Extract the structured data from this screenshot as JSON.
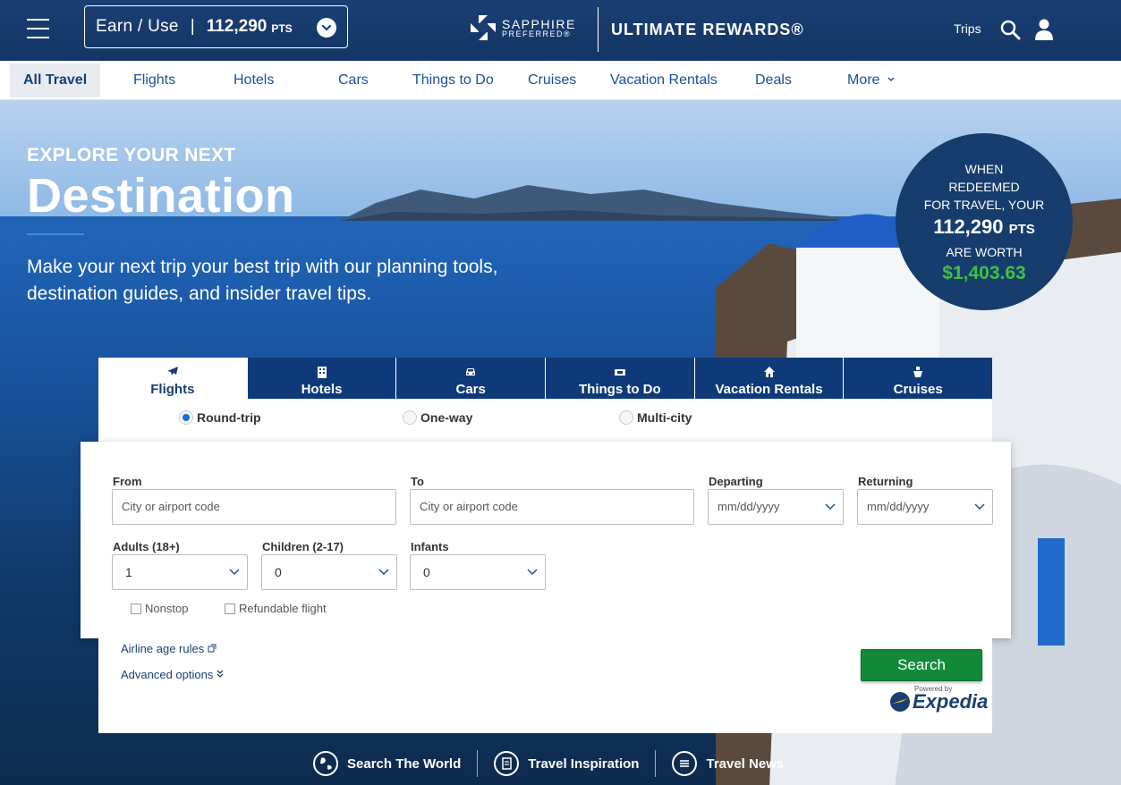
{
  "header": {
    "earn_label": "Earn / Use",
    "separator": "|",
    "points": "112,290",
    "points_unit": "PTS",
    "brand_line1": "SAPPHIRE",
    "brand_line2": "PREFERRED®",
    "program": "ULTIMATE REWARDS®",
    "trips": "Trips"
  },
  "nav": {
    "items": [
      {
        "label": "All Travel"
      },
      {
        "label": "Flights"
      },
      {
        "label": "Hotels"
      },
      {
        "label": "Cars"
      },
      {
        "label": "Things to Do"
      },
      {
        "label": "Cruises"
      },
      {
        "label": "Vacation Rentals"
      },
      {
        "label": "Deals"
      },
      {
        "label": "More ⌵"
      }
    ],
    "more_label": "More"
  },
  "hero": {
    "kicker": "EXPLORE YOUR NEXT",
    "title": "Destination",
    "subtitle": "Make your next trip your best trip with our planning tools, destination guides, and insider travel tips."
  },
  "redeem": {
    "line1": "WHEN",
    "line2": "REDEEMED",
    "line3": "FOR TRAVEL, YOUR",
    "points": "112,290",
    "points_unit": "PTS",
    "line4": "ARE WORTH",
    "value": "$1,403.63",
    "value_color": "#3fc23f"
  },
  "tabs": [
    {
      "label": "Flights",
      "icon": "airplane-icon"
    },
    {
      "label": "Hotels",
      "icon": "building-icon"
    },
    {
      "label": "Cars",
      "icon": "car-icon"
    },
    {
      "label": "Things to Do",
      "icon": "ticket-icon"
    },
    {
      "label": "Vacation Rentals",
      "icon": "house-icon"
    },
    {
      "label": "Cruises",
      "icon": "ship-icon"
    }
  ],
  "trip_type": {
    "round_trip": "Round-trip",
    "one_way": "One-way",
    "multi_city": "Multi-city",
    "selected": "Round-trip"
  },
  "form": {
    "from_label": "From",
    "from_placeholder": "City or airport code",
    "to_label": "To",
    "to_placeholder": "City or airport code",
    "departing_label": "Departing",
    "departing_placeholder": "mm/dd/yyyy",
    "returning_label": "Returning",
    "returning_placeholder": "mm/dd/yyyy",
    "adults_label": "Adults (18+)",
    "adults_value": "1",
    "children_label": "Children (2-17)",
    "children_value": "0",
    "infants_label": "Infants",
    "infants_value": "0",
    "nonstop": "Nonstop",
    "refundable": "Refundable flight"
  },
  "lower": {
    "airline_rules": "Airline age rules",
    "advanced": "Advanced options",
    "search_button": "Search",
    "powered_by": "Powered by",
    "expedia": "Expedia"
  },
  "footer": {
    "search_world": "Search The World",
    "inspiration": "Travel Inspiration",
    "news": "Travel News"
  },
  "colors": {
    "header_bg": "#143665",
    "accent_blue": "#1a4f9c",
    "tab_bg": "#0f3a7a",
    "search_green": "#138a3a"
  }
}
